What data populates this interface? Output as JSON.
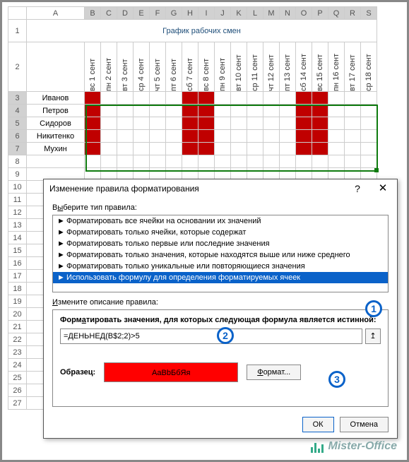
{
  "title": "График рабочих смен",
  "columns": [
    "A",
    "B",
    "C",
    "D",
    "E",
    "F",
    "G",
    "H",
    "I",
    "J",
    "K",
    "L",
    "M",
    "N",
    "O",
    "P",
    "Q",
    "R",
    "S"
  ],
  "rows_visible": [
    1,
    2,
    3,
    4,
    5,
    6,
    7,
    8,
    9,
    10,
    11,
    12,
    13,
    14,
    15,
    16,
    17,
    18,
    19,
    20,
    21,
    22,
    23,
    24,
    25,
    26,
    27
  ],
  "date_headers": [
    "вс 1 сент",
    "пн 2 сент",
    "вт 3 сент",
    "ср 4 сент",
    "чт 5 сент",
    "пт 6 сент",
    "сб 7 сент",
    "вс 8 сент",
    "пн 9 сент",
    "вт 10 сент",
    "ср 11 сент",
    "чт 12 сент",
    "пт 13 сент",
    "сб 14 сент",
    "вс 15 сент",
    "пн 16 сент",
    "вт 17 сент",
    "ср 18 сент"
  ],
  "names": [
    "Иванов",
    "Петров",
    "Сидоров",
    "Никитенко",
    "Мухин"
  ],
  "weekend_cols": [
    0,
    6,
    7,
    13,
    14
  ],
  "dialog": {
    "title": "Изменение правила форматирования",
    "help": "?",
    "close": "✕",
    "section1_label": "Выберите тип правила:",
    "rules": [
      "Форматировать все ячейки на основании их значений",
      "Форматировать только ячейки, которые содержат",
      "Форматировать только первые или последние значения",
      "Форматировать только значения, которые находятся выше или ниже среднего",
      "Форматировать только уникальные или повторяющиеся значения",
      "Использовать формулу для определения форматируемых ячеек"
    ],
    "selected_rule_index": 5,
    "section2_label": "Измените описание правила:",
    "formula_label": "Форматировать значения, для которых следующая формула является истинной:",
    "formula_value": "=ДЕНЬНЕД(B$2;2)>5",
    "sample_label": "Образец:",
    "sample_text": "АаВbБбЯя",
    "format_btn": "Формат...",
    "ok_btn": "ОК",
    "cancel_btn": "Отмена"
  },
  "badges": [
    "1",
    "2",
    "3"
  ],
  "watermark": "Mister-Office"
}
